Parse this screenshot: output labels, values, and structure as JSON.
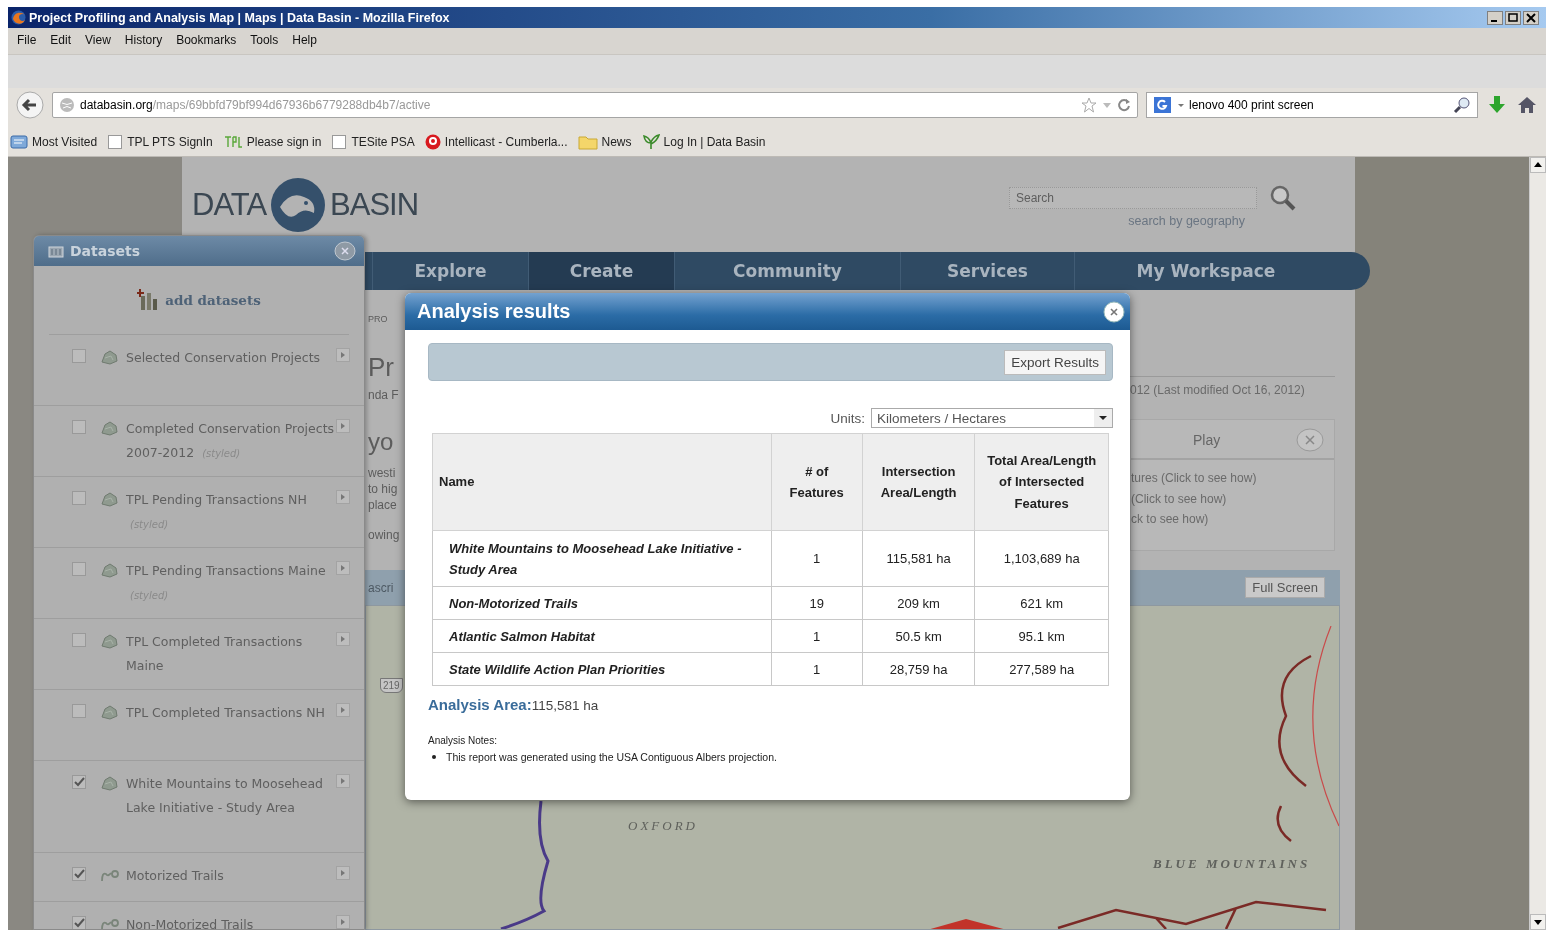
{
  "window": {
    "title": "Project Profiling and Analysis Map | Maps | Data Basin - Mozilla Firefox"
  },
  "menu": [
    "File",
    "Edit",
    "View",
    "History",
    "Bookmarks",
    "Tools",
    "Help"
  ],
  "address_bar": {
    "domain": "databasin.org",
    "path": "/maps/69bbfd79bf994d67936b6779288db4b7/active"
  },
  "search_bar": {
    "value": "lenovo 400 print screen"
  },
  "bookmarks": [
    {
      "label": "Most Visited",
      "kind": "smart"
    },
    {
      "label": "TPL PTS SignIn",
      "kind": "blank"
    },
    {
      "label": "Please sign in",
      "kind": "tpl"
    },
    {
      "label": "TESite PSA",
      "kind": "blank"
    },
    {
      "label": "Intellicast - Cumberla...",
      "kind": "intellicast"
    },
    {
      "label": "News",
      "kind": "folder"
    },
    {
      "label": "Log In | Data Basin",
      "kind": "plant"
    }
  ],
  "site": {
    "logo": {
      "left": "DATA",
      "right": "BASIN"
    },
    "search": {
      "placeholder": "Search"
    },
    "geo_link": "search by geography",
    "nav": [
      {
        "label": "Explore",
        "selected": false
      },
      {
        "label": "Create",
        "selected": true
      },
      {
        "label": "Community",
        "selected": false
      },
      {
        "label": "Services",
        "selected": false
      },
      {
        "label": "My Workspace",
        "selected": false
      }
    ],
    "left_fragments": [
      "PRO",
      "Pr",
      "nda F",
      "yo",
      "westi",
      "to hig",
      "place",
      "owing"
    ],
    "modified": "012 (Last modified Oct 16, 2012)",
    "play_panel": {
      "tab": "Play",
      "lines": [
        "tures (Click to see how)",
        "(Click to see how)",
        "ck to see how)"
      ]
    },
    "map": {
      "toolbar_fragment": "ascri",
      "button": "Full Screen",
      "labels": [
        "OXFORD",
        "BLUE MOUNTAINS"
      ],
      "shield": "219"
    }
  },
  "datasets": {
    "title": "Datasets",
    "add": "add datasets",
    "items": [
      {
        "name": "Selected Conservation Projects",
        "kind": "polygon",
        "checked": false
      },
      {
        "name": "Completed Conservation Projects 2007-2012",
        "note": "(styled)",
        "kind": "polygon",
        "checked": false
      },
      {
        "name": "TPL Pending Transactions NH",
        "note": "(styled)",
        "kind": "polygon",
        "checked": false
      },
      {
        "name": "TPL Pending Transactions Maine",
        "note": "(styled)",
        "kind": "polygon",
        "checked": false
      },
      {
        "name": "TPL Completed Transactions Maine",
        "kind": "polygon",
        "checked": false
      },
      {
        "name": "TPL Completed Transactions NH",
        "kind": "polygon",
        "checked": false
      },
      {
        "name": "White Mountains to Moosehead Lake Initiative - Study Area",
        "kind": "polygon",
        "checked": true
      },
      {
        "name": "Motorized Trails",
        "kind": "line",
        "checked": true
      },
      {
        "name": "Non-Motorized Trails",
        "kind": "line",
        "checked": true
      }
    ]
  },
  "modal": {
    "title": "Analysis results",
    "export": "Export Results",
    "units": {
      "label": "Units:",
      "value": "Kilometers / Hectares"
    },
    "table": {
      "columns": [
        "Name",
        "# of Features",
        "Intersection Area/Length",
        "Total Area/Length of Intersected Features"
      ],
      "rows": [
        [
          "White Mountains to Moosehead Lake Initiative - Study Area",
          "1",
          "115,581 ha",
          "1,103,689 ha"
        ],
        [
          "Non-Motorized Trails",
          "19",
          "209 km",
          "621 km"
        ],
        [
          "Atlantic Salmon Habitat",
          "1",
          "50.5 km",
          "95.1 km"
        ],
        [
          "State Wildlife Action Plan Priorities",
          "1",
          "28,759 ha",
          "277,589 ha"
        ]
      ]
    },
    "analysis_area": {
      "label": "Analysis Area:",
      "value": "115,581 ha"
    },
    "notes": {
      "title": "Analysis Notes:",
      "items": [
        "This report was generated using the USA Contiguous Albers projection."
      ]
    }
  }
}
